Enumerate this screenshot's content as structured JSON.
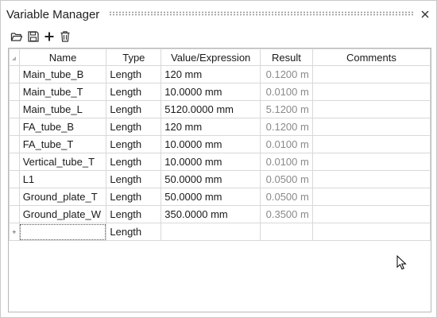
{
  "window": {
    "title": "Variable Manager"
  },
  "toolbar": {
    "icons": [
      "open-folder-icon",
      "save-icon",
      "add-icon",
      "delete-icon"
    ]
  },
  "table": {
    "columns": [
      "Name",
      "Type",
      "Value/Expression",
      "Result",
      "Comments"
    ],
    "rows": [
      {
        "name": "Main_tube_B",
        "type": "Length",
        "value": "120 mm",
        "result": "0.1200 m",
        "comments": ""
      },
      {
        "name": "Main_tube_T",
        "type": "Length",
        "value": "10.0000 mm",
        "result": "0.0100 m",
        "comments": ""
      },
      {
        "name": "Main_tube_L",
        "type": "Length",
        "value": "5120.0000 mm",
        "result": "5.1200 m",
        "comments": ""
      },
      {
        "name": "FA_tube_B",
        "type": "Length",
        "value": "120 mm",
        "result": "0.1200 m",
        "comments": ""
      },
      {
        "name": "FA_tube_T",
        "type": "Length",
        "value": "10.0000 mm",
        "result": "0.0100 m",
        "comments": ""
      },
      {
        "name": "Vertical_tube_T",
        "type": "Length",
        "value": "10.0000 mm",
        "result": "0.0100 m",
        "comments": ""
      },
      {
        "name": "L1",
        "type": "Length",
        "value": "50.0000 mm",
        "result": "0.0500 m",
        "comments": ""
      },
      {
        "name": "Ground_plate_T",
        "type": "Length",
        "value": "50.0000 mm",
        "result": "0.0500 m",
        "comments": ""
      },
      {
        "name": "Ground_plate_W",
        "type": "Length",
        "value": "350.0000 mm",
        "result": "0.3500 m",
        "comments": ""
      }
    ],
    "new_row": {
      "marker": "+",
      "name": "",
      "type": "Length",
      "value": "",
      "result": "",
      "comments": ""
    }
  }
}
